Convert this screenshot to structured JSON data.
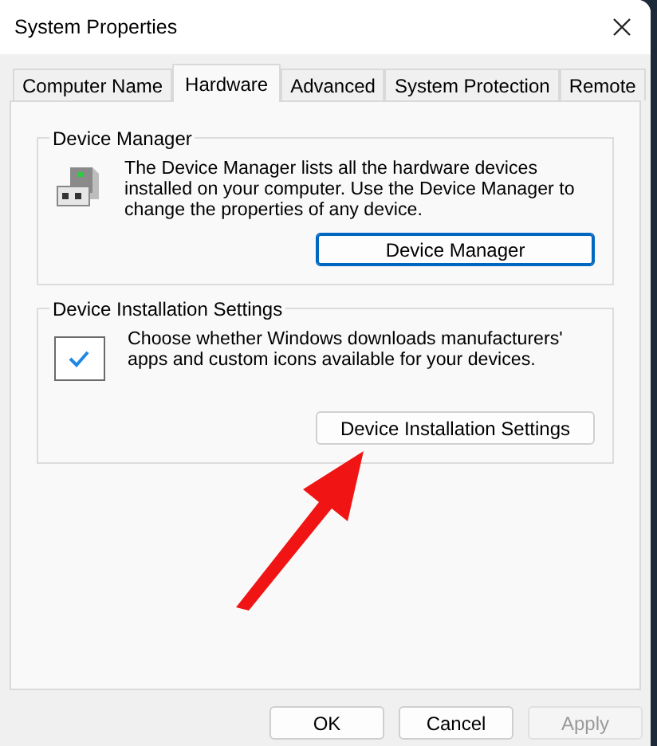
{
  "window": {
    "title": "System Properties"
  },
  "tabs": [
    {
      "label": "Computer Name",
      "selected": false
    },
    {
      "label": "Hardware",
      "selected": true
    },
    {
      "label": "Advanced",
      "selected": false
    },
    {
      "label": "System Protection",
      "selected": false
    },
    {
      "label": "Remote",
      "selected": false
    }
  ],
  "groups": [
    {
      "title": "Device Manager",
      "kind": "device-manager",
      "description": "The Device Manager lists all the hardware devices installed on your computer. Use the Device Manager to change the properties of any device.",
      "button": {
        "label": "Device Manager",
        "focused": true
      }
    },
    {
      "title": "Device Installation Settings",
      "kind": "installation",
      "description": "Choose whether Windows downloads manufacturers' apps and custom icons available for your devices.",
      "button": {
        "label": "Device Installation Settings",
        "focused": false
      }
    }
  ],
  "buttons": [
    {
      "label": "OK",
      "disabled": false
    },
    {
      "label": "Cancel",
      "disabled": false
    },
    {
      "label": "Apply",
      "disabled": true
    }
  ]
}
